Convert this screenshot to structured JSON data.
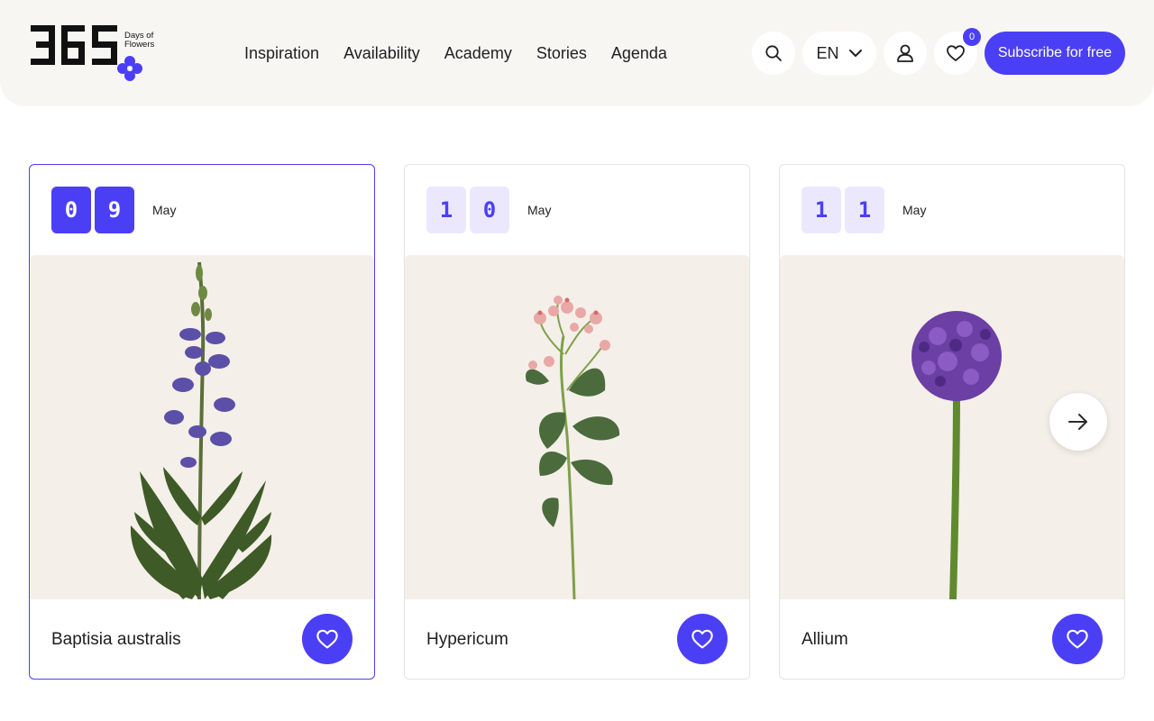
{
  "brand": {
    "sub1": "Days of",
    "sub2": "Flowers",
    "accent": "#4b3ff5",
    "bg": "#f8f6f3"
  },
  "nav": {
    "items": [
      "Inspiration",
      "Availability",
      "Academy",
      "Stories",
      "Agenda"
    ]
  },
  "header": {
    "search_icon": "search-icon",
    "language": "EN",
    "account_icon": "user-icon",
    "favorites_icon": "heart-icon",
    "favorites_count": "0",
    "subscribe_label": "Subscribe for free"
  },
  "cards": [
    {
      "d1": "0",
      "d2": "9",
      "month": "May",
      "name": "Baptisia australis",
      "active": true
    },
    {
      "d1": "1",
      "d2": "0",
      "month": "May",
      "name": "Hypericum",
      "active": false
    },
    {
      "d1": "1",
      "d2": "1",
      "month": "May",
      "name": "Allium",
      "active": false
    }
  ],
  "carousel": {
    "next_icon": "arrow-right-icon"
  }
}
